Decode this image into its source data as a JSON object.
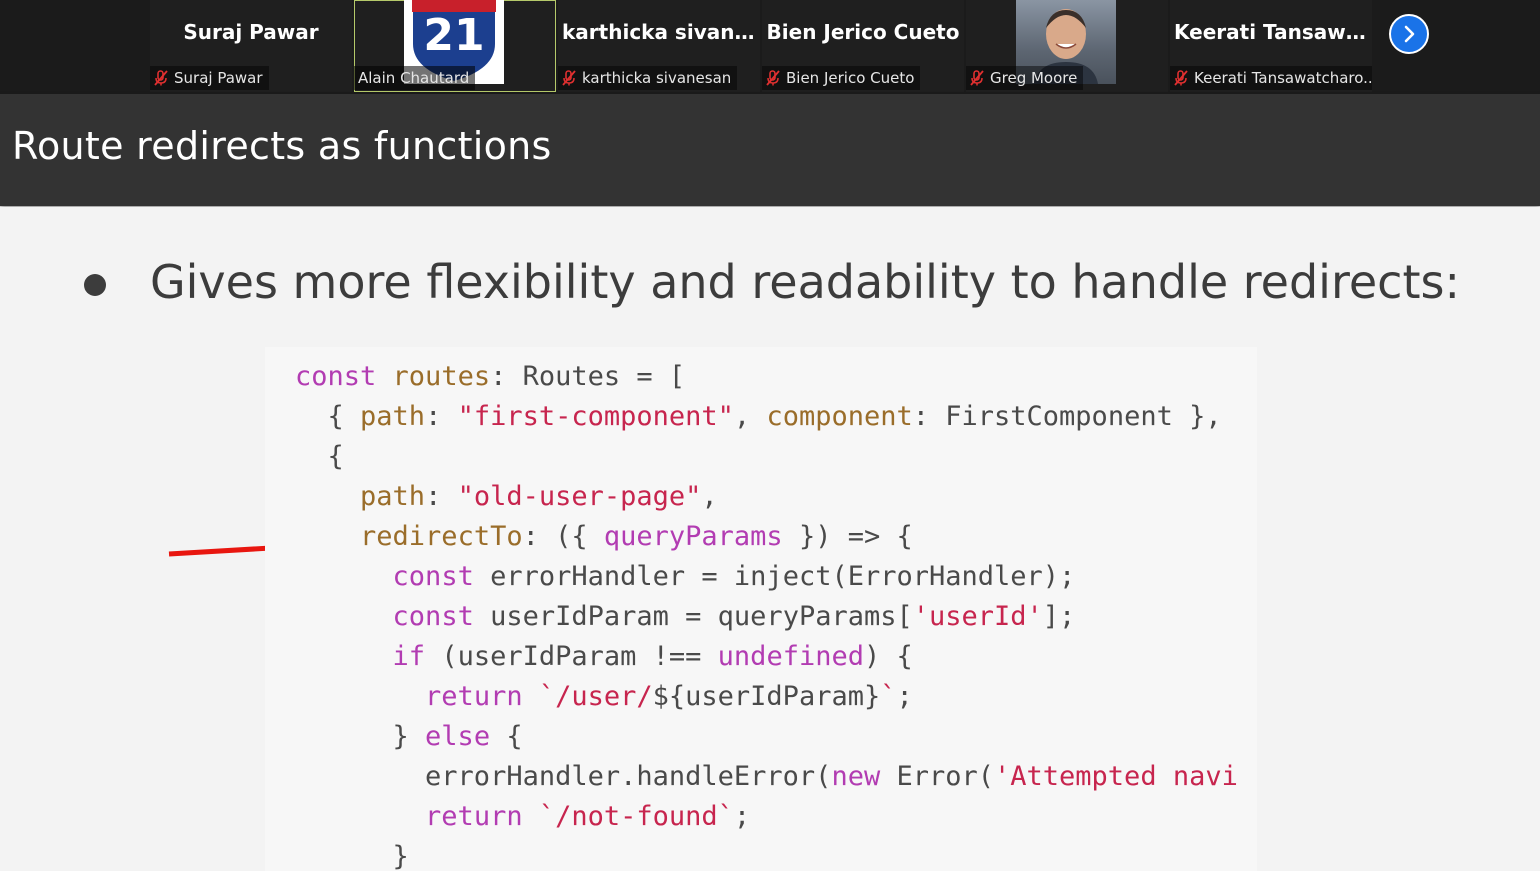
{
  "participants": [
    {
      "tile_name": "Suraj Pawar",
      "label": "Suraj Pawar",
      "muted": true
    },
    {
      "tile_name": "",
      "label": "Alain Chautard",
      "muted": false,
      "video": "route-21-shield",
      "shield_number": "21",
      "active": true
    },
    {
      "tile_name": "karthicka  sivane...",
      "label": "karthicka sivanesan",
      "muted": true
    },
    {
      "tile_name": "Bien Jerico Cueto",
      "label": "Bien Jerico Cueto",
      "muted": true
    },
    {
      "tile_name": "",
      "label": "Greg Moore",
      "muted": true,
      "video": "person-photo"
    },
    {
      "tile_name": "Keerati  Tansawa...",
      "label": "Keerati Tansawatcharo...",
      "muted": true
    }
  ],
  "next_button_icon": "chevron-right-icon",
  "slide": {
    "title": "Route redirects as functions",
    "bullet": "Gives more flexibility and readability to handle redirects:",
    "code_lines": [
      [
        [
          "kw",
          "const "
        ],
        [
          "prop",
          "routes"
        ],
        [
          "plain",
          ": Routes = ["
        ]
      ],
      [
        [
          "plain",
          "  { "
        ],
        [
          "prop",
          "path"
        ],
        [
          "plain",
          ": "
        ],
        [
          "str",
          "\"first-component\""
        ],
        [
          "plain",
          ", "
        ],
        [
          "prop",
          "component"
        ],
        [
          "plain",
          ": FirstComponent },"
        ]
      ],
      [
        [
          "plain",
          "  {"
        ]
      ],
      [
        [
          "plain",
          "    "
        ],
        [
          "prop",
          "path"
        ],
        [
          "plain",
          ": "
        ],
        [
          "str",
          "\"old-user-page\""
        ],
        [
          "plain",
          ","
        ]
      ],
      [
        [
          "plain",
          "    "
        ],
        [
          "prop",
          "redirectTo"
        ],
        [
          "plain",
          ": ({ "
        ],
        [
          "kw",
          "queryParams"
        ],
        [
          "plain",
          " }) => {"
        ]
      ],
      [
        [
          "plain",
          "      "
        ],
        [
          "kw",
          "const "
        ],
        [
          "plain",
          "errorHandler = inject(ErrorHandler);"
        ]
      ],
      [
        [
          "plain",
          "      "
        ],
        [
          "kw",
          "const "
        ],
        [
          "plain",
          "userIdParam = queryParams["
        ],
        [
          "str",
          "'userId'"
        ],
        [
          "plain",
          "];"
        ]
      ],
      [
        [
          "plain",
          "      "
        ],
        [
          "kw",
          "if "
        ],
        [
          "plain",
          "(userIdParam !== "
        ],
        [
          "kw",
          "undefined"
        ],
        [
          "plain",
          ") {"
        ]
      ],
      [
        [
          "plain",
          "        "
        ],
        [
          "kw",
          "return "
        ],
        [
          "str",
          "`/user/"
        ],
        [
          "plain",
          "${userIdParam}"
        ],
        [
          "str",
          "`"
        ],
        [
          "plain",
          ";"
        ]
      ],
      [
        [
          "plain",
          "      } "
        ],
        [
          "kw",
          "else "
        ],
        [
          "plain",
          "{"
        ]
      ],
      [
        [
          "plain",
          "        errorHandler.handleError("
        ],
        [
          "kw",
          "new "
        ],
        [
          "plain",
          "Error("
        ],
        [
          "str",
          "'Attempted navi"
        ]
      ],
      [
        [
          "plain",
          "        "
        ],
        [
          "kw",
          "return "
        ],
        [
          "str",
          "`/not-found`"
        ],
        [
          "plain",
          ";"
        ]
      ],
      [
        [
          "plain",
          "      }"
        ]
      ]
    ]
  },
  "colors": {
    "keyword": "#b23cb2",
    "property": "#9a6d2a",
    "string": "#c7254e",
    "arrow": "#e8160f",
    "next_button": "#1a73e8"
  }
}
